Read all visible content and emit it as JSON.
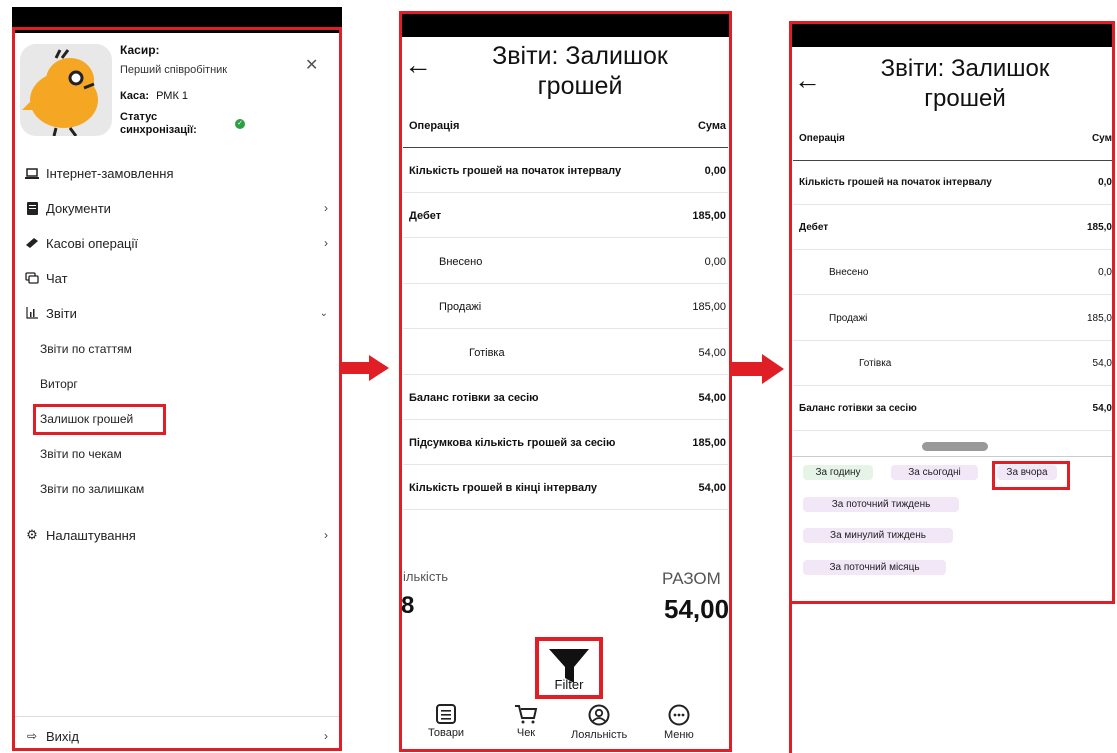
{
  "panel1": {
    "cashier_label": "Касир:",
    "cashier_value": "Перший співробітник",
    "register_label": "Каса:",
    "register_value": "РМК 1",
    "sync_label_line1": "Статус",
    "sync_label_line2": "синхронізації:",
    "menu": {
      "internet_orders": "Інтернет-замовлення",
      "documents": "Документи",
      "cash_ops": "Касові операції",
      "chat": "Чат",
      "reports": "Звіти",
      "settings": "Налаштування",
      "exit": "Вихід"
    },
    "reports_sub": {
      "by_articles": "Звіти по статтям",
      "revenue": "Виторг",
      "cash_balance": "Залишок грошей",
      "by_receipts": "Звіти по чекам",
      "by_stock": "Звіти по залишкам"
    }
  },
  "report": {
    "title_line1": "Звіти: Залишок",
    "title_line2": "грошей",
    "col_operation": "Операція",
    "col_sum": "Сума",
    "col_sum_cut": "Сум",
    "rows": [
      {
        "label": "Кількість грошей на початок інтервалу",
        "value": "0,00",
        "value_cut": "0,0"
      },
      {
        "label": "Дебет",
        "value": "185,00",
        "value_cut": "185,0"
      },
      {
        "label": "Внесено",
        "value": "0,00",
        "value_cut": "0,0"
      },
      {
        "label": "Продажі",
        "value": "185,00",
        "value_cut": "185,0"
      },
      {
        "label": "Готівка",
        "value": "54,00",
        "value_cut": "54,0"
      },
      {
        "label": "Баланс готівки за сесію",
        "value": "54,00",
        "value_cut": "54,0"
      },
      {
        "label": "Підсумкова кількість грошей за сесію",
        "value": "185,00"
      },
      {
        "label": "Кількість грошей в кінці інтервалу",
        "value": "54,00"
      }
    ],
    "count_label": "Кількість",
    "count_label_cut": "ількість",
    "count_value": "8",
    "total_label": "РАЗОМ",
    "total_value": "54,00",
    "filter_label": "Filter"
  },
  "bottom_nav": {
    "goods": "Товари",
    "receipt": "Чек",
    "loyalty": "Лояльність",
    "menu": "Меню"
  },
  "filters": {
    "hour": "За годину",
    "today": "За сьогодні",
    "yesterday": "За вчора",
    "this_week": "За поточний тиждень",
    "last_week": "За минулий тиждень",
    "this_month": "За поточний місяць"
  },
  "colors": {
    "highlight_red": "#e01e26",
    "sync_ok_green": "#2e9e44",
    "mascot_orange": "#f5a623",
    "chip_green": "#e6f4e8",
    "chip_purple": "#f1e7f7"
  }
}
